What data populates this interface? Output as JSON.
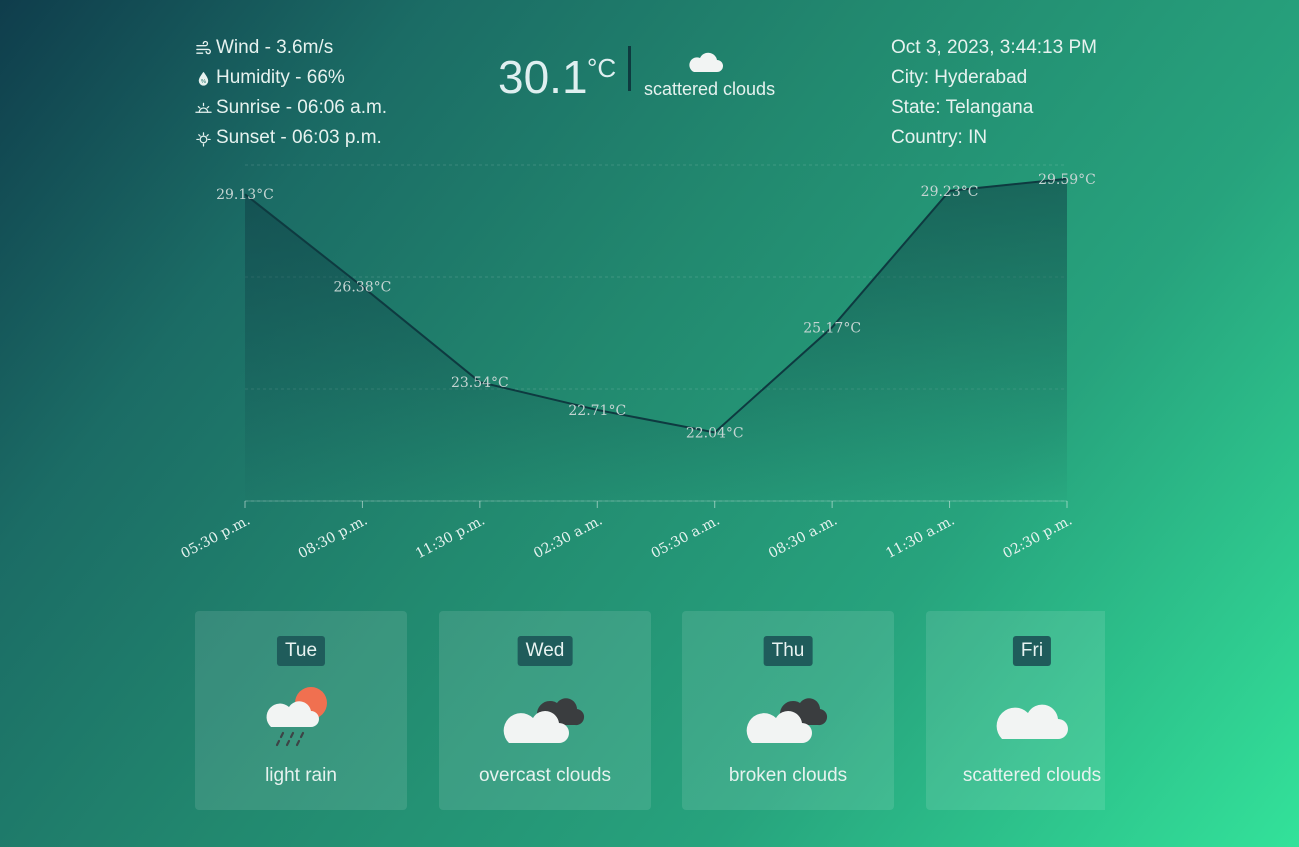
{
  "details": {
    "wind": "Wind - 3.6m/s",
    "humidity": "Humidity - 66%",
    "sunrise": "Sunrise - 06:06 a.m.",
    "sunset": "Sunset - 06:03 p.m."
  },
  "current": {
    "temperature": "30.1",
    "unit": "°C",
    "description": "scattered clouds",
    "icon": "cloud-icon"
  },
  "location": {
    "datetime": "Oct 3, 2023, 3:44:13 PM",
    "city": "City: Hyderabad",
    "state": "State: Telangana",
    "country": "Country: IN"
  },
  "chart_data": {
    "type": "area",
    "x": [
      "05:30 p.m.",
      "08:30 p.m.",
      "11:30 p.m.",
      "02:30 a.m.",
      "05:30 a.m.",
      "08:30 a.m.",
      "11:30 a.m.",
      "02:30 p.m."
    ],
    "values": [
      29.13,
      26.38,
      23.54,
      22.71,
      22.04,
      25.17,
      29.23,
      29.59
    ],
    "labels": [
      "29.13°C",
      "26.38°C",
      "23.54°C",
      "22.71°C",
      "22.04°C",
      "25.17°C",
      "29.23°C",
      "29.59°C"
    ],
    "ylim": [
      20.0,
      30.0
    ],
    "grid": true,
    "colors": {
      "line": "#0e3a40",
      "fill": "#0f3d44"
    }
  },
  "forecast": [
    {
      "day": "Tue",
      "description": "light rain",
      "icon": "rain-sun-icon"
    },
    {
      "day": "Wed",
      "description": "overcast clouds",
      "icon": "overcast-clouds-icon"
    },
    {
      "day": "Thu",
      "description": "broken clouds",
      "icon": "broken-clouds-icon"
    },
    {
      "day": "Fri",
      "description": "scattered clouds",
      "icon": "scattered-clouds-icon"
    }
  ]
}
